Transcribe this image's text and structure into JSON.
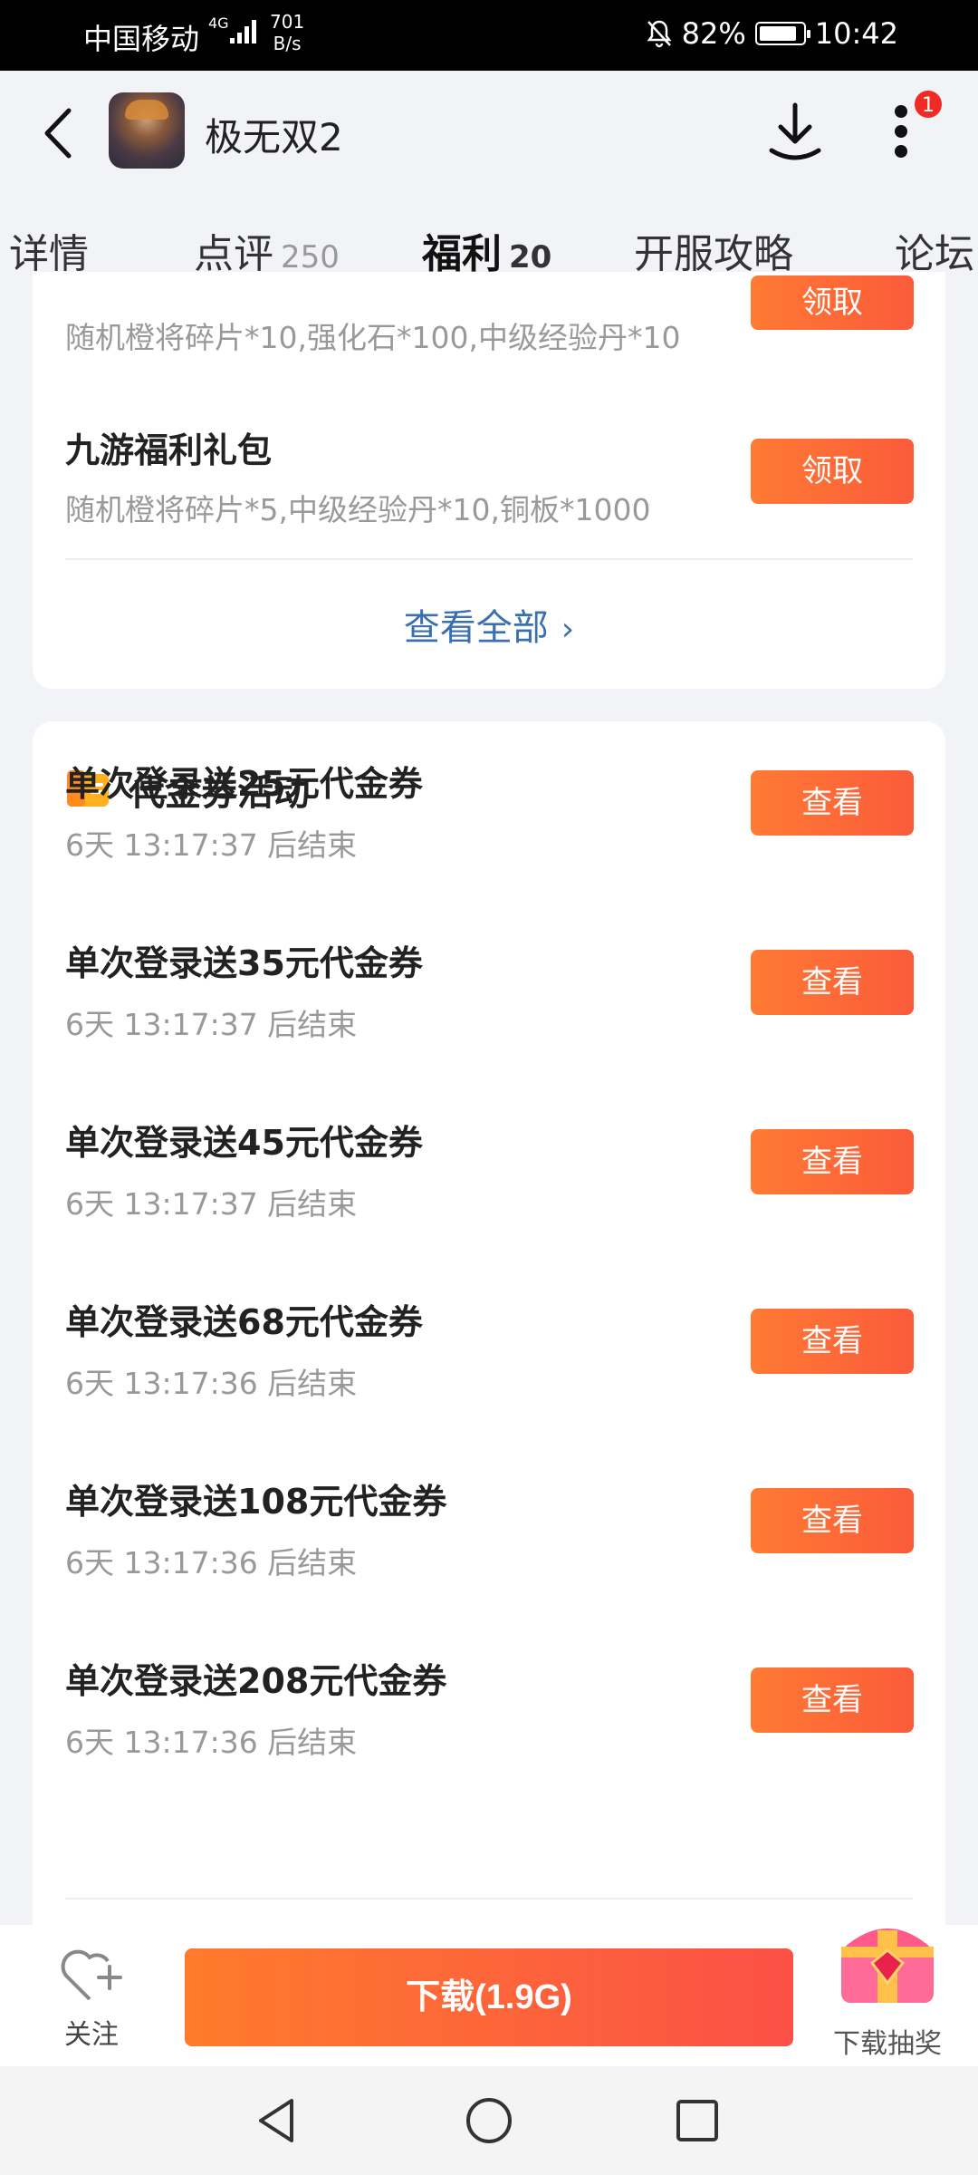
{
  "status_bar": {
    "carrier": "中国移动",
    "network": "4G",
    "speed_value": "701",
    "speed_unit": "B/s",
    "battery": "82%",
    "time": "10:42"
  },
  "header": {
    "title": "极无双2",
    "notification_count": "1"
  },
  "tabs": [
    {
      "label": "详情",
      "count": ""
    },
    {
      "label": "点评",
      "count": "250"
    },
    {
      "label": "福利",
      "count": "20"
    },
    {
      "label": "开服攻略",
      "count": ""
    },
    {
      "label": "论坛",
      "count": ""
    }
  ],
  "gifts": {
    "partial_item": {
      "subtitle": "随机橙将碎片*10,强化石*100,中级经验丹*10",
      "button": "领取"
    },
    "items": [
      {
        "title": "九游福利礼包",
        "subtitle": "随机橙将碎片*5,中级经验丹*10,铜板*1000",
        "button": "领取"
      }
    ],
    "see_all": "查看全部"
  },
  "coupons": {
    "section_title": "代金券活动",
    "items": [
      {
        "title": "单次登录送25元代金券",
        "countdown": "6天 13:17:37 后结束",
        "button": "查看"
      },
      {
        "title": "单次登录送35元代金券",
        "countdown": "6天 13:17:37 后结束",
        "button": "查看"
      },
      {
        "title": "单次登录送45元代金券",
        "countdown": "6天 13:17:37 后结束",
        "button": "查看"
      },
      {
        "title": "单次登录送68元代金券",
        "countdown": "6天 13:17:36 后结束",
        "button": "查看"
      },
      {
        "title": "单次登录送108元代金券",
        "countdown": "6天 13:17:36 后结束",
        "button": "查看"
      },
      {
        "title": "单次登录送208元代金券",
        "countdown": "6天 13:17:36 后结束",
        "button": "查看"
      }
    ]
  },
  "bottom_bar": {
    "follow_label": "关注",
    "download_label": "下载(1.9G)",
    "lottery_label": "下载抽奖"
  },
  "colors": {
    "accent": "#fb6a38",
    "link": "#3a6fb0",
    "badge": "#f02a24"
  }
}
